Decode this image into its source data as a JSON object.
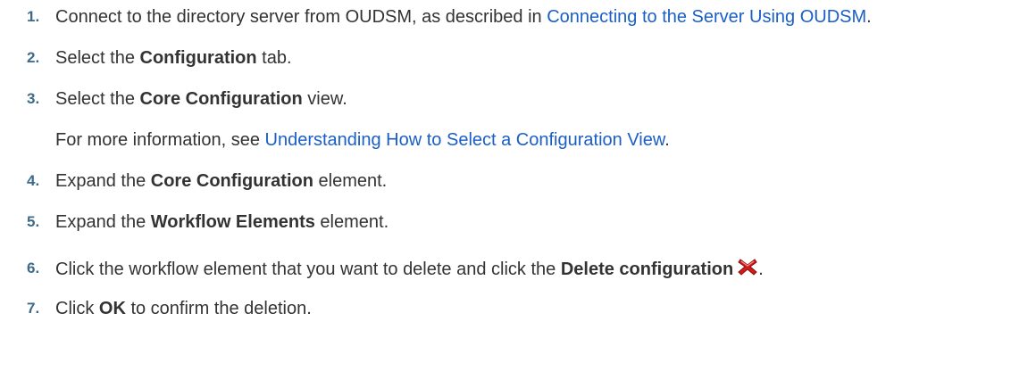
{
  "steps": [
    {
      "num": "1.",
      "pre": "Connect to the directory server from OUDSM, as described in ",
      "link": "Connecting to the Server Using OUDSM",
      "post": "."
    },
    {
      "num": "2.",
      "pre": "Select the ",
      "bold": "Configuration",
      "post": " tab."
    },
    {
      "num": "3.",
      "pre": "Select the ",
      "bold": "Core Configuration",
      "post": " view."
    },
    {
      "note_pre": "For more information, see ",
      "note_link": "Understanding How to Select a Configuration View",
      "note_post": "."
    },
    {
      "num": "4.",
      "pre": "Expand the ",
      "bold": "Core Configuration",
      "post": " element."
    },
    {
      "num": "5.",
      "pre": "Expand the ",
      "bold": "Workflow Elements",
      "post": " element."
    },
    {
      "num": "6.",
      "pre": "Click the workflow element that you want to delete and click the ",
      "bold": "Delete configuration",
      "post": "."
    },
    {
      "num": "7.",
      "pre": "Click ",
      "bold": "OK",
      "post": " to confirm the deletion."
    }
  ],
  "colors": {
    "number": "#3f6b8a",
    "link": "#1a5fc7",
    "text": "#333333",
    "delete_icon": "#d11a1a"
  },
  "icons": {
    "delete": "delete-x-icon"
  }
}
